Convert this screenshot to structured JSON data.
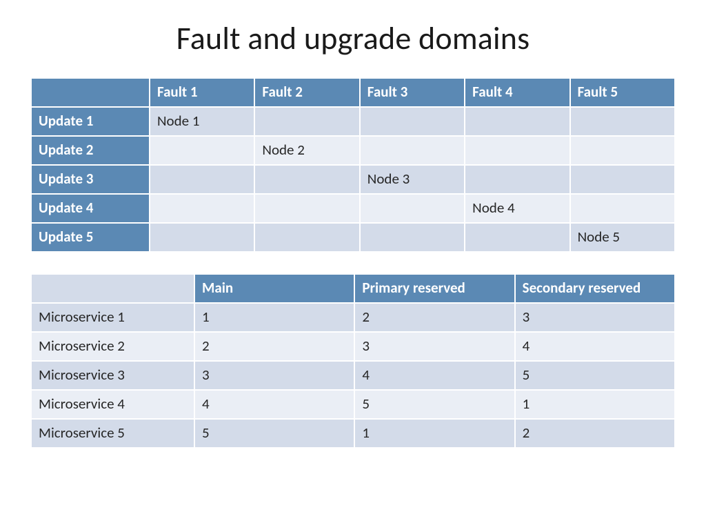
{
  "title": "Fault and upgrade domains",
  "table1": {
    "col_headers": [
      "Fault 1",
      "Fault 2",
      "Fault 3",
      "Fault 4",
      "Fault 5"
    ],
    "row_headers": [
      "Update 1",
      "Update 2",
      "Update 3",
      "Update 4",
      "Update 5"
    ],
    "cells": [
      [
        "Node 1",
        "",
        "",
        "",
        ""
      ],
      [
        "",
        "Node 2",
        "",
        "",
        ""
      ],
      [
        "",
        "",
        "Node 3",
        "",
        ""
      ],
      [
        "",
        "",
        "",
        "Node 4",
        ""
      ],
      [
        "",
        "",
        "",
        "",
        "Node 5"
      ]
    ]
  },
  "table2": {
    "col_headers": [
      "Main",
      "Primary reserved",
      "Secondary reserved"
    ],
    "row_headers": [
      "Microservice 1",
      "Microservice 2",
      "Microservice 3",
      "Microservice 4",
      "Microservice 5"
    ],
    "cells": [
      [
        "1",
        "2",
        "3"
      ],
      [
        "2",
        "3",
        "4"
      ],
      [
        "3",
        "4",
        "5"
      ],
      [
        "4",
        "5",
        "1"
      ],
      [
        "5",
        "1",
        "2"
      ]
    ]
  }
}
